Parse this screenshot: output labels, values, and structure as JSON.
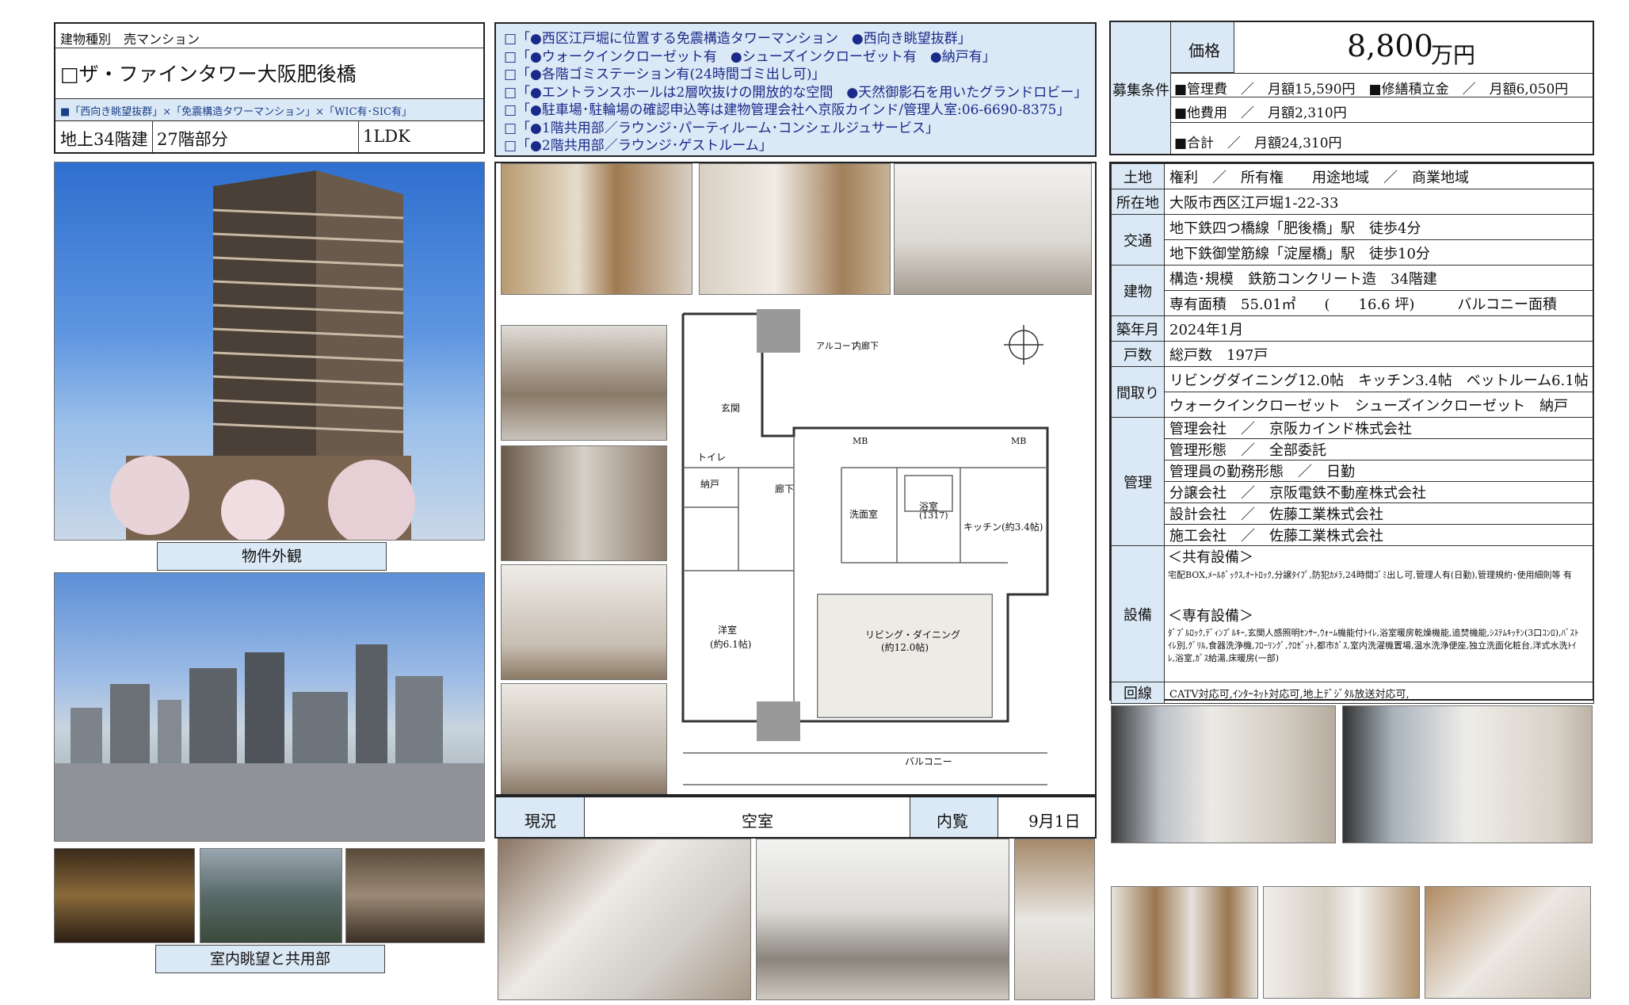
{
  "header": {
    "type_label": "建物種別　売マンション",
    "name": "□ザ・ファインタワー大阪肥後橋",
    "tags": "■「西向き眺望抜群」×「免震構造タワーマンション」×「WIC有･SIC有」",
    "floors": "地上34階建",
    "floor_part": "27階部分",
    "layout": "1LDK"
  },
  "features": [
    "□「●西区江戸堀に位置する免震構造タワーマンション　●西向き眺望抜群」",
    "□「●ウォークインクローゼット有　●シューズインクローゼット有　●納戸有」",
    "□「●各階ゴミステーション有(24時間ゴミ出し可)」",
    "□「●エントランスホールは2層吹抜けの開放的な空間　●天然御影石を用いたグランドロビー」",
    "□「●駐車場･駐輪場の確認申込等は建物管理会社へ京阪カインド/管理人室:06-6690-8375」",
    "□「●1階共用部／ラウンジ･パーティルーム･コンシェルジュサービス」",
    "□「●2階共用部／ラウンジ･ゲストルーム」"
  ],
  "price": {
    "section_label": "募集条件",
    "price_label": "価格",
    "price_value": "8,800",
    "price_unit": "万円",
    "fees_line": "■管理費　／　月額15,590円　■修繕積立金　／　月額6,050円",
    "other_fees": "■他費用　／　月額2,310円",
    "total": "■合計　／　月額24,310円"
  },
  "details": {
    "land_label": "土地",
    "land_value": "権利　／　所有権　　用途地域　／　商業地域",
    "address_label": "所在地",
    "address_value": "大阪市西区江戸堀1-22-33",
    "transport_label": "交通",
    "transport_1": "地下鉄四つ橋線「肥後橋」駅　徒歩4分",
    "transport_2": "地下鉄御堂筋線「淀屋橋」駅　徒歩10分",
    "building_label": "建物",
    "building_1": "構造･規模　鉄筋コンクリート造　34階建",
    "building_2": "専有面積　55.01㎡　　(　　16.6 坪)　　　バルコニー面積",
    "built_label": "築年月",
    "built_value": "2024年1月",
    "units_label": "戸数",
    "units_value": "総戸数　197戸",
    "layout_label": "間取り",
    "layout_1": "リビングダイニング12.0帖　キッチン3.4帖　ベットルーム6.1帖",
    "layout_2": "ウォークインクローゼット　シューズインクローゼット　納戸",
    "mgmt_label": "管理",
    "mgmt_rows": [
      "管理会社　／　京阪カインド株式会社",
      "管理形態　／　全部委託",
      "管理員の勤務形態　／　日勤",
      "分譲会社　／　京阪電鉄不動産株式会社",
      "設計会社　／　佐藤工業株式会社",
      "施工会社　／　佐藤工業株式会社"
    ],
    "equip_label": "設備",
    "common_head": "＜共有設備＞",
    "common_text": "宅配BOX,ﾒｰﾙﾎﾞｯｸｽ,ｵｰﾄﾛｯｸ,分譲ﾀｲﾌﾟ,防犯ｶﾒﾗ,24時間ｺﾞﾐ出し可,管理人有(日勤),管理規約･使用細則等 有",
    "private_head": "＜専有設備＞",
    "private_text": "ﾀﾞﾌﾞﾙﾛｯｸ,ﾃﾞｨﾝﾌﾟﾙｷｰ,玄関人感照明ｾﾝｻｰ,ｳｫｰﾑ機能付ﾄｲﾚ,浴室暖房乾燥機能,追焚機能,ｼｽﾃﾑｷｯﾁﾝ(3口ｺﾝﾛ),ﾊﾞｽﾄｲﾚ別,ｸﾞﾘﾙ,食器洗浄機,ﾌﾛｰﾘﾝｸﾞ,ｸﾛｾﾞｯﾄ,都市ｶﾞｽ,室内洗濯機置場,温水洗浄便座,独立洗面化粧台,洋式水洗ﾄｲﾚ,浴室,ｶﾞｽ給湯,床暖房(一部)",
    "line_label": "回線",
    "line_value": "CATV対応可,ｲﾝﾀｰﾈｯﾄ対応可,地上ﾃﾞｼﾞﾀﾙ放送対応可,"
  },
  "captions": {
    "exterior": "物件外観",
    "view": "室内眺望と共用部"
  },
  "status": {
    "status_label": "現況",
    "status_value": "空室",
    "viewing_label": "内覧",
    "viewing_value": "9月1日"
  },
  "floorplan": {
    "rooms": {
      "entrance": "玄関",
      "toilet": "トイレ",
      "storage": "納戸",
      "hall": "廊下",
      "washroom": "洗面室",
      "bath": "浴室",
      "bath_size": "(1317)",
      "kitchen": "キッチン(約3.4帖)",
      "bedroom": "洋室",
      "bedroom_size": "(約6.1帖)",
      "living": "リビング・ダイニング",
      "living_size": "(約12.0帖)",
      "balcony": "バルコニー",
      "alcove": "アルコーブ",
      "corridor": "内廊下",
      "mb1": "MB",
      "mb2": "MB"
    }
  },
  "colors": {
    "label_bg": "#dbe8f5",
    "feature_text": "#1a2a8a",
    "border": "#222222"
  }
}
